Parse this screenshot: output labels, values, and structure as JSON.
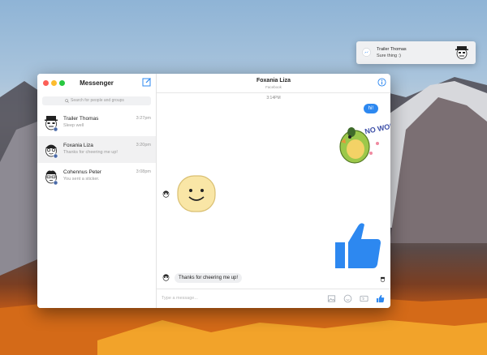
{
  "notification": {
    "title": "Trailer Thomas",
    "message": "Sure thing :)"
  },
  "sidebar": {
    "title": "Messenger",
    "search_placeholder": "Search for people and groups",
    "conversations": [
      {
        "name": "Trailer Thomas",
        "preview": "Sleep well",
        "time": "3:27pm"
      },
      {
        "name": "Foxania Liza",
        "preview": "Thanks for cheering me up!",
        "time": "3:20pm"
      },
      {
        "name": "Cohennus Peter",
        "preview": "You sent a sticker.",
        "time": "3:08pm"
      }
    ]
  },
  "chat": {
    "name": "Foxania Liza",
    "subtitle": "Facebook",
    "timestamp": "3:14PM",
    "sticker_text": "NO WORRIES",
    "messages": [
      {
        "from": "me",
        "text": "hi!"
      },
      {
        "from": "them",
        "text": "Thanks for cheering me up!"
      }
    ],
    "input_placeholder": "Type a message..."
  },
  "colors": {
    "accent": "#2d88f0",
    "close": "#fc5f57",
    "minimize": "#fdbc2e",
    "zoom": "#28c840"
  }
}
